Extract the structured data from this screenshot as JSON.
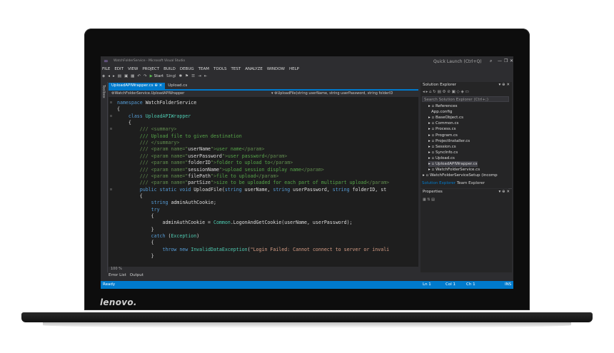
{
  "window": {
    "title": "WatchFolderService - Microsoft Visual Studio",
    "quick_launch": "Quick Launch (Ctrl+Q)",
    "min": "—",
    "restore": "❐",
    "close": "✕"
  },
  "menu": [
    "FILE",
    "EDIT",
    "VIEW",
    "PROJECT",
    "BUILD",
    "DEBUG",
    "TEAM",
    "TOOLS",
    "TEST",
    "ANALYZE",
    "WINDOW",
    "HELP"
  ],
  "toolbar": {
    "start_label": "Start",
    "config": "Singl"
  },
  "toolbox_label": "Toolbox",
  "tabs": [
    {
      "label": "UploadAPIWrapper.cs",
      "pin": "⊕",
      "close": "×",
      "active": true
    },
    {
      "label": "Upload.cs",
      "active": false
    }
  ],
  "nav": {
    "class_path": "WatchFolderService.UploadAPIWrapper",
    "member": "UploadFile(string userName, string userPassword, string folderID"
  },
  "code": [
    {
      "t": [
        [
          "kw",
          "namespace "
        ],
        [
          "tx",
          "WatchFolderService"
        ]
      ]
    },
    {
      "t": [
        [
          "tx",
          "{"
        ]
      ]
    },
    {
      "t": [
        [
          "tx",
          "    "
        ],
        [
          "kw",
          "class "
        ],
        [
          "ty",
          "UploadAPIWrapper"
        ]
      ]
    },
    {
      "t": [
        [
          "tx",
          "    {"
        ]
      ]
    },
    {
      "t": [
        [
          "xd",
          "        /// <summary>"
        ]
      ]
    },
    {
      "t": [
        [
          "cm",
          "        /// Upload file to given destination"
        ]
      ]
    },
    {
      "t": [
        [
          "xd",
          "        /// </summary>"
        ]
      ]
    },
    {
      "t": [
        [
          "xd",
          "        /// <param name=\""
        ],
        [
          "tx",
          "userName"
        ],
        [
          "xd",
          "\">"
        ],
        [
          "cm",
          "user name"
        ],
        [
          "xd",
          "</param>"
        ]
      ]
    },
    {
      "t": [
        [
          "xd",
          "        /// <param name=\""
        ],
        [
          "tx",
          "userPassword"
        ],
        [
          "xd",
          "\">"
        ],
        [
          "cm",
          "user password"
        ],
        [
          "xd",
          "</param>"
        ]
      ]
    },
    {
      "t": [
        [
          "xd",
          "        /// <param name=\""
        ],
        [
          "tx",
          "folderID"
        ],
        [
          "xd",
          "\">"
        ],
        [
          "cm",
          "folder to upload to"
        ],
        [
          "xd",
          "</param>"
        ]
      ]
    },
    {
      "t": [
        [
          "xd",
          "        /// <param name=\""
        ],
        [
          "tx",
          "sessionName"
        ],
        [
          "xd",
          "\">"
        ],
        [
          "cm",
          "upload session display name"
        ],
        [
          "xd",
          "</param>"
        ]
      ]
    },
    {
      "t": [
        [
          "xd",
          "        /// <param name=\""
        ],
        [
          "tx",
          "filePath"
        ],
        [
          "xd",
          "\">"
        ],
        [
          "cm",
          "file to upload"
        ],
        [
          "xd",
          "</param>"
        ]
      ]
    },
    {
      "t": [
        [
          "xd",
          "        /// <param name=\""
        ],
        [
          "tx",
          "partSize"
        ],
        [
          "xd",
          "\">"
        ],
        [
          "cm",
          "size to be uploaded for each part of multipart upload"
        ],
        [
          "xd",
          "</param>"
        ]
      ]
    },
    {
      "t": [
        [
          "kw",
          "        public static void "
        ],
        [
          "tx",
          "UploadFile("
        ],
        [
          "kw",
          "string "
        ],
        [
          "tx",
          "userName, "
        ],
        [
          "kw",
          "string "
        ],
        [
          "tx",
          "userPassword, "
        ],
        [
          "kw",
          "string "
        ],
        [
          "tx",
          "folderID, st"
        ]
      ]
    },
    {
      "t": [
        [
          "tx",
          "        {"
        ]
      ]
    },
    {
      "t": [
        [
          "kw",
          "            string "
        ],
        [
          "tx",
          "adminAuthCookie;"
        ]
      ]
    },
    {
      "t": [
        [
          "kw",
          "            try"
        ]
      ]
    },
    {
      "t": [
        [
          "tx",
          "            {"
        ]
      ]
    },
    {
      "t": [
        [
          "tx",
          "                adminAuthCookie = "
        ],
        [
          "ty",
          "Common"
        ],
        [
          "tx",
          ".LogonAndGetCookie(userName, userPassword);"
        ]
      ]
    },
    {
      "t": [
        [
          "tx",
          "            }"
        ]
      ]
    },
    {
      "t": [
        [
          "kw",
          "            catch "
        ],
        [
          "tx",
          "("
        ],
        [
          "ty",
          "Exception"
        ],
        [
          "tx",
          ")"
        ]
      ]
    },
    {
      "t": [
        [
          "tx",
          "            {"
        ]
      ]
    },
    {
      "t": [
        [
          "kw",
          "                throw new "
        ],
        [
          "ty",
          "InvalidDataException"
        ],
        [
          "tx",
          "("
        ],
        [
          "st",
          "\"Login Failed: Cannot connect to server or invali"
        ]
      ]
    },
    {
      "t": [
        [
          "tx",
          "            }"
        ]
      ]
    }
  ],
  "editor": {
    "zoom": "100 %"
  },
  "bottom_tabs": [
    "Error List",
    "Output"
  ],
  "status": {
    "ready": "Ready",
    "ln": "Ln 1",
    "col": "Col 1",
    "ch": "Ch 1",
    "ins": "INS"
  },
  "solution_explorer": {
    "title": "Solution Explorer",
    "search": "Search Solution Explorer (Ctrl+;)",
    "items": [
      {
        "label": "▸ ▫ References",
        "indent": 2
      },
      {
        "label": "App.config",
        "indent": 3
      },
      {
        "label": "▸ ▫ BaseObject.cs",
        "indent": 2
      },
      {
        "label": "▸ ▫ Common.cs",
        "indent": 2
      },
      {
        "label": "▸ ▫ Process.cs",
        "indent": 2
      },
      {
        "label": "▸ ▫ Program.cs",
        "indent": 2
      },
      {
        "label": "▸ ▫ ProjectInstaller.cs",
        "indent": 2
      },
      {
        "label": "▸ ▫ Session.cs",
        "indent": 2
      },
      {
        "label": "▸ ▫ SyncInfo.cs",
        "indent": 2
      },
      {
        "label": "▸ ▫ Upload.cs",
        "indent": 2
      },
      {
        "label": "▸ ▫ UploadAPIWrapper.cs",
        "indent": 2,
        "selected": true
      },
      {
        "label": "▸ ▫ WatchFolderService.cs",
        "indent": 2
      },
      {
        "label": "▸ ▫ WatchFolderServiceSetup (incomp",
        "indent": 0
      }
    ],
    "tab_active": "Solution Explorer",
    "tab_other": "Team Explorer"
  },
  "properties": {
    "title": "Properties"
  },
  "laptop": {
    "brand": "lenovo."
  }
}
